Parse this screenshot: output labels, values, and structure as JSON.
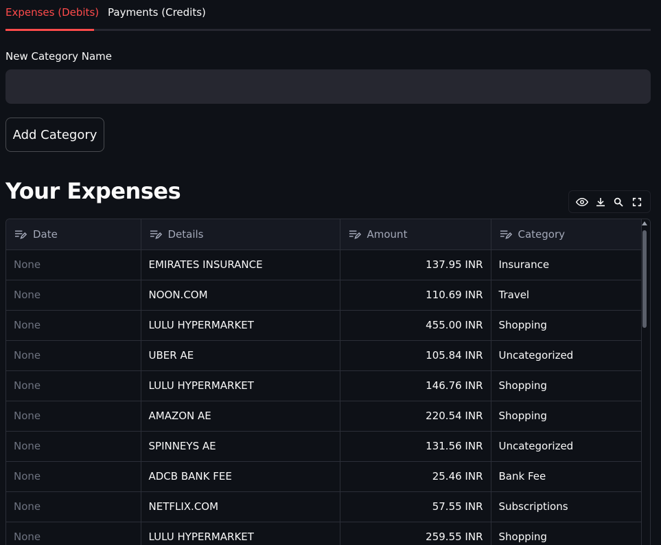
{
  "tabs": [
    {
      "label": "Expenses (Debits)",
      "active": true
    },
    {
      "label": "Payments (Credits)",
      "active": false
    }
  ],
  "form": {
    "label": "New Category Name",
    "value": "",
    "placeholder": "",
    "button_label": "Add Category"
  },
  "heading": "Your Expenses",
  "toolbar": {
    "icons": [
      "eye-icon",
      "download-icon",
      "search-icon",
      "fullscreen-icon"
    ]
  },
  "grid": {
    "columns": [
      "Date",
      "Details",
      "Amount",
      "Category"
    ],
    "rows": [
      {
        "date": "None",
        "details": "EMIRATES INSURANCE",
        "amount": "137.95 INR",
        "category": "Insurance"
      },
      {
        "date": "None",
        "details": "NOON.COM",
        "amount": "110.69 INR",
        "category": "Travel"
      },
      {
        "date": "None",
        "details": "LULU HYPERMARKET",
        "amount": "455.00 INR",
        "category": "Shopping"
      },
      {
        "date": "None",
        "details": "UBER AE",
        "amount": "105.84 INR",
        "category": "Uncategorized"
      },
      {
        "date": "None",
        "details": "LULU HYPERMARKET",
        "amount": "146.76 INR",
        "category": "Shopping"
      },
      {
        "date": "None",
        "details": "AMAZON AE",
        "amount": "220.54 INR",
        "category": "Shopping"
      },
      {
        "date": "None",
        "details": "SPINNEYS AE",
        "amount": "131.56 INR",
        "category": "Uncategorized"
      },
      {
        "date": "None",
        "details": "ADCB BANK FEE",
        "amount": "25.46 INR",
        "category": "Bank Fee"
      },
      {
        "date": "None",
        "details": "NETFLIX.COM",
        "amount": "57.55 INR",
        "category": "Subscriptions"
      },
      {
        "date": "None",
        "details": "LULU HYPERMARKET",
        "amount": "259.55 INR",
        "category": "Shopping"
      }
    ]
  },
  "colors": {
    "background": "#0e1117",
    "accent": "#ff4b4b",
    "input_bg": "#262730",
    "grid_border": "#2c2f38",
    "header_text": "#a3a8b8",
    "muted_text": "#6e7380"
  }
}
